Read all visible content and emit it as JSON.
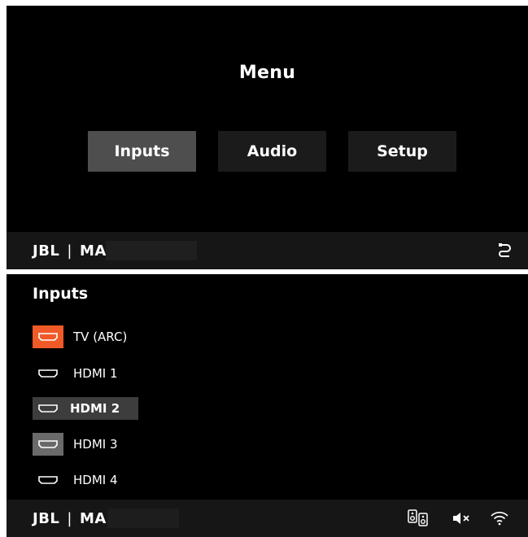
{
  "menu_screen": {
    "title": "Menu",
    "buttons": [
      {
        "label": "Inputs",
        "selected": true
      },
      {
        "label": "Audio",
        "selected": false
      },
      {
        "label": "Setup",
        "selected": false
      }
    ],
    "footer": {
      "brand": "JBL",
      "separator": "|",
      "model": "MA",
      "icon": "hdmi-cable-icon"
    }
  },
  "inputs_screen": {
    "title": "Inputs",
    "items": [
      {
        "label": "TV (ARC)",
        "icon": "hdmi-port-icon",
        "state": "active"
      },
      {
        "label": "HDMI 1",
        "icon": "hdmi-port-icon",
        "state": "normal"
      },
      {
        "label": "HDMI 2",
        "icon": "hdmi-port-icon",
        "state": "highlighted"
      },
      {
        "label": "HDMI 3",
        "icon": "hdmi-port-icon",
        "state": "dim"
      },
      {
        "label": "HDMI 4",
        "icon": "hdmi-port-icon",
        "state": "normal"
      }
    ],
    "footer": {
      "brand": "JBL",
      "separator": "|",
      "model": "MA",
      "icons": [
        "speakers-icon",
        "mute-icon",
        "wifi-icon"
      ]
    }
  },
  "colors": {
    "background": "#000000",
    "active_source": "#f05a28",
    "selected_button": "#4e4e4e",
    "footer": "#161616"
  }
}
